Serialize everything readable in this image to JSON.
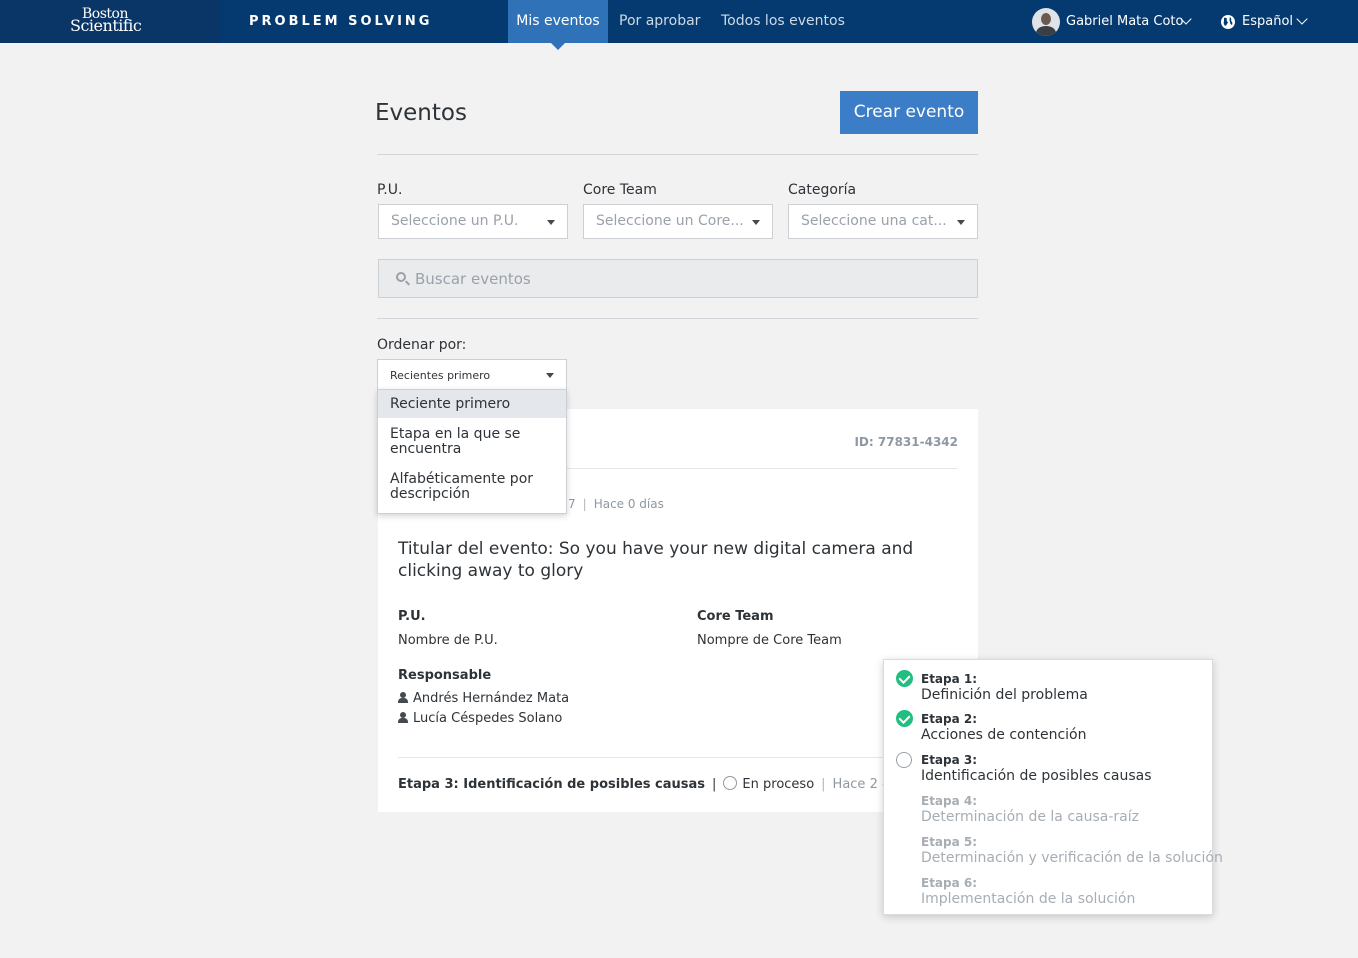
{
  "header": {
    "logo_line1": "Boston",
    "logo_line2": "Scientific",
    "app_title": "PROBLEM SOLVING",
    "tabs": [
      {
        "label": "Mis eventos",
        "active": true
      },
      {
        "label": "Por aprobar",
        "active": false
      },
      {
        "label": "Todos los eventos",
        "active": false
      }
    ],
    "user_name": "Gabriel Mata Coto",
    "language": "Español"
  },
  "page": {
    "title": "Eventos",
    "create_button": "Crear evento"
  },
  "filters": {
    "pu_label": "P.U.",
    "pu_placeholder": "Seleccione un P.U.",
    "core_label": "Core Team",
    "core_placeholder": "Seleccione un Core...",
    "cat_label": "Categoría",
    "cat_placeholder": "Seleccione una cat..."
  },
  "search": {
    "placeholder": "Buscar eventos"
  },
  "sort": {
    "label": "Ordenar por:",
    "selected": "Recientes primero",
    "options": [
      "Reciente primero",
      "Etapa en la que se encuentra",
      "Alfabéticamente por descripción"
    ]
  },
  "event": {
    "id": "ID: 77831-4342",
    "meta_fragment": "7",
    "meta_ago": "Hace 0 días",
    "title": "Titular del evento: So you have your new digital camera and clicking away to glory",
    "pu_heading": "P.U.",
    "pu_value": "Nombre de P.U.",
    "core_heading": "Core Team",
    "core_value": "Nompre de Core Team",
    "resp_heading": "Responsable",
    "responsables": [
      "Andrés Hernández Mata",
      "Lucía Céspedes Solano"
    ],
    "stage_label": "Etapa 3: Identificación de posibles causas",
    "status": "En proceso",
    "stage_ago": "Hace 2 día"
  },
  "stages": [
    {
      "label": "Etapa 1:",
      "desc": "Definición del problema",
      "state": "done"
    },
    {
      "label": "Etapa 2:",
      "desc": "Acciones de contención",
      "state": "done"
    },
    {
      "label": "Etapa 3:",
      "desc": "Identificación de posibles causas",
      "state": "current"
    },
    {
      "label": "Etapa 4:",
      "desc": "Determinación de la causa-raíz",
      "state": "todo"
    },
    {
      "label": "Etapa 5:",
      "desc": "Determinación y verificación de la solución",
      "state": "todo"
    },
    {
      "label": "Etapa 6:",
      "desc": "Implementación de la solución",
      "state": "todo"
    }
  ],
  "colors": {
    "header_bg": "#043a70",
    "active_tab": "#2f72b8",
    "primary_button": "#3b7dc7",
    "done_check": "#1fbf80"
  }
}
